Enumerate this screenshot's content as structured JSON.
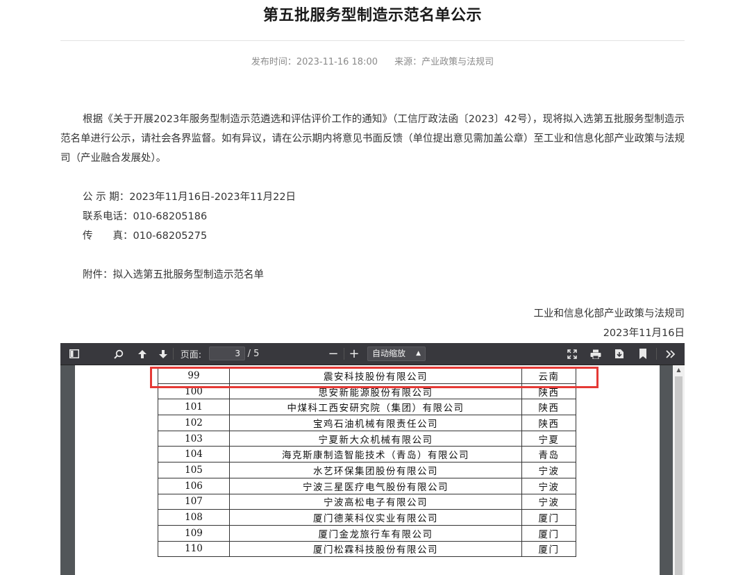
{
  "article": {
    "title": "第五批服务型制造示范名单公示",
    "publish_time": "发布时间：2023-11-16 18:00",
    "source": "来源：产业政策与法规司",
    "paragraph": "根据《关于开展2023年服务型制造示范遴选和评估评价工作的通知》（工信厅政法函〔2023〕42号），现将拟入选第五批服务型制造示范名单进行公示，请社会各界监督。如有异议，请在公示期内将意见书面反馈（单位提出意见需加盖公章）至工业和信息化部产业政策与法规司（产业融合发展处）。",
    "period": "公 示 期：2023年11月16日-2023年11月22日",
    "phone": "联系电话：010-68205186",
    "fax": "传　　真：010-68205275",
    "attachment": "附件：拟入选第五批服务型制造示范名单",
    "signer": "工业和信息化部产业政策与法规司",
    "sign_date": "2023年11月16日"
  },
  "viewer": {
    "page_label": "页面:",
    "current_page": "3",
    "total_pages": "/ 5",
    "zoom_label": "自动缩放",
    "zoom_out": "−",
    "zoom_in": "+",
    "icons": [
      "sidebar-toggle-icon",
      "search-icon",
      "arrow-up-icon",
      "arrow-down-icon",
      "fullscreen-icon",
      "print-icon",
      "download-icon",
      "bookmark-icon",
      "more-tools-icon"
    ]
  },
  "table": {
    "rows": [
      {
        "no": "99",
        "name": "震安科技股份有限公司",
        "region": "云南"
      },
      {
        "no": "100",
        "name": "思安新能源股份有限公司",
        "region": "陕西"
      },
      {
        "no": "101",
        "name": "中煤科工西安研究院（集团）有限公司",
        "region": "陕西"
      },
      {
        "no": "102",
        "name": "宝鸡石油机械有限责任公司",
        "region": "陕西"
      },
      {
        "no": "103",
        "name": "宁夏新大众机械有限公司",
        "region": "宁夏"
      },
      {
        "no": "104",
        "name": "海克斯康制造智能技术（青岛）有限公司",
        "region": "青岛"
      },
      {
        "no": "105",
        "name": "水艺环保集团股份有限公司",
        "region": "宁波"
      },
      {
        "no": "106",
        "name": "宁波三星医疗电气股份有限公司",
        "region": "宁波"
      },
      {
        "no": "107",
        "name": "宁波高松电子有限公司",
        "region": "宁波"
      },
      {
        "no": "108",
        "name": "厦门德莱科仪实业有限公司",
        "region": "厦门"
      },
      {
        "no": "109",
        "name": "厦门金龙旅行车有限公司",
        "region": "厦门"
      },
      {
        "no": "110",
        "name": "厦门松霖科技股份有限公司",
        "region": "厦门"
      }
    ]
  },
  "colors": {
    "highlight": "#e53935",
    "toolbar_bg": "#38383d",
    "viewer_bg": "#525659"
  }
}
